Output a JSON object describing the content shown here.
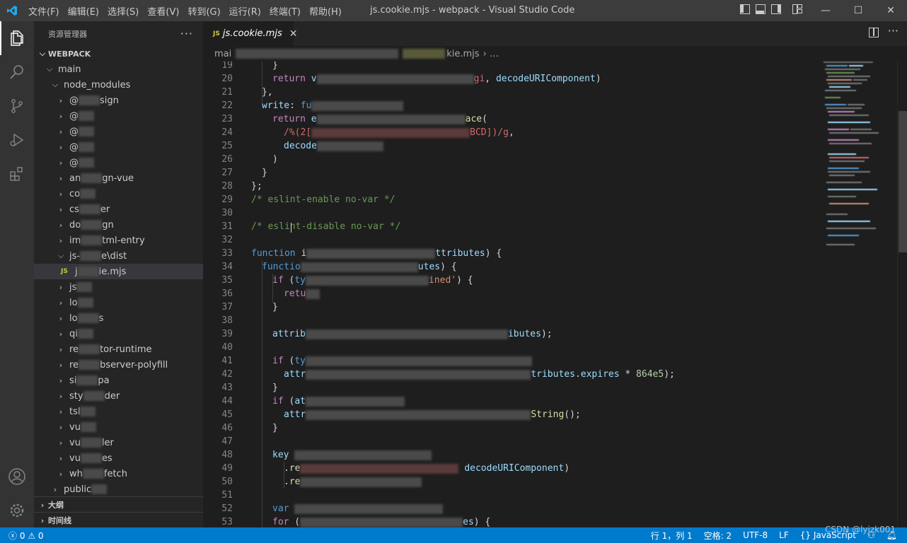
{
  "window": {
    "menu": [
      "文件(F)",
      "编辑(E)",
      "选择(S)",
      "查看(V)",
      "转到(G)",
      "运行(R)",
      "终端(T)",
      "帮助(H)"
    ],
    "title": "js.cookie.mjs - webpack - Visual Studio Code",
    "controls": {
      "minimize": "—",
      "maximize": "☐",
      "close": "✕"
    }
  },
  "activity_bar": {
    "icons": [
      "explorer-icon",
      "search-icon",
      "source-control-icon",
      "run-debug-icon",
      "extensions-icon"
    ],
    "bottom_icons": [
      "account-icon",
      "manage-gear-icon"
    ]
  },
  "sidebar": {
    "title": "资源管理器",
    "more": "···",
    "workspace": "WEBPACK",
    "tree": [
      {
        "label": "main",
        "chev": "⌵"
      },
      {
        "label": "node_modules",
        "chev": "⌵"
      },
      {
        "label": "@",
        "suffix": "sign",
        "chev": "›"
      },
      {
        "label": "@",
        "suffix": "",
        "chev": "›"
      },
      {
        "label": "@",
        "suffix": "",
        "chev": "›"
      },
      {
        "label": "@",
        "suffix": "",
        "chev": "›"
      },
      {
        "label": "@",
        "suffix": "",
        "chev": "›"
      },
      {
        "label": "an",
        "suffix": "gn-vue",
        "chev": "›"
      },
      {
        "label": "co",
        "suffix": "",
        "chev": "›"
      },
      {
        "label": "cs",
        "suffix": "er",
        "chev": "›"
      },
      {
        "label": "do",
        "suffix": "gn",
        "chev": "›"
      },
      {
        "label": "im",
        "suffix": "tml-entry",
        "chev": "›"
      },
      {
        "label": "js-",
        "suffix": "e\\dist",
        "chev": "⌵"
      },
      {
        "label": "j",
        "suffix": "ie.mjs",
        "file": true
      },
      {
        "label": "js",
        "suffix": "",
        "chev": "›"
      },
      {
        "label": "lo",
        "suffix": "",
        "chev": "›"
      },
      {
        "label": "lo",
        "suffix": "s",
        "chev": "›"
      },
      {
        "label": "qi",
        "suffix": "",
        "chev": "›"
      },
      {
        "label": "re",
        "suffix": "tor-runtime",
        "chev": "›"
      },
      {
        "label": "re",
        "suffix": "bserver-polyfill",
        "chev": "›"
      },
      {
        "label": "si",
        "suffix": "pa",
        "chev": "›"
      },
      {
        "label": "sty",
        "suffix": "der",
        "chev": "›"
      },
      {
        "label": "tsl",
        "suffix": "",
        "chev": "›"
      },
      {
        "label": "vu",
        "suffix": "",
        "chev": "›"
      },
      {
        "label": "vu",
        "suffix": "ler",
        "chev": "›"
      },
      {
        "label": "vu",
        "suffix": "es",
        "chev": "›"
      },
      {
        "label": "wh",
        "suffix": "fetch",
        "chev": "›"
      },
      {
        "label": "public",
        "suffix": "",
        "chev": "›"
      }
    ],
    "outline": "大纲",
    "timeline": "时间线",
    "file_badge": "JS"
  },
  "tab": {
    "label": "js.cookie.mjs",
    "badge": "JS",
    "close": "✕"
  },
  "breadcrumb": {
    "start": "mai",
    "end": "kie.mjs",
    "tail": "›  …"
  },
  "editor": {
    "line_numbers": [
      "19",
      "20",
      "21",
      "22",
      "23",
      "24",
      "25",
      "26",
      "27",
      "28",
      "29",
      "30",
      "31",
      "32",
      "33",
      "34",
      "35",
      "36",
      "37",
      "38",
      "39",
      "40",
      "41",
      "42",
      "43",
      "44",
      "45",
      "46",
      "47",
      "48",
      "49",
      "50",
      "51",
      "52",
      "53"
    ]
  },
  "statusbar": {
    "errors": "0",
    "warnings": "0",
    "position": "行 1，列 1",
    "spaces": "空格: 2",
    "encoding": "UTF-8",
    "eol": "LF",
    "language": "JavaScript",
    "watermark": "CSDN @lyjzk001"
  }
}
